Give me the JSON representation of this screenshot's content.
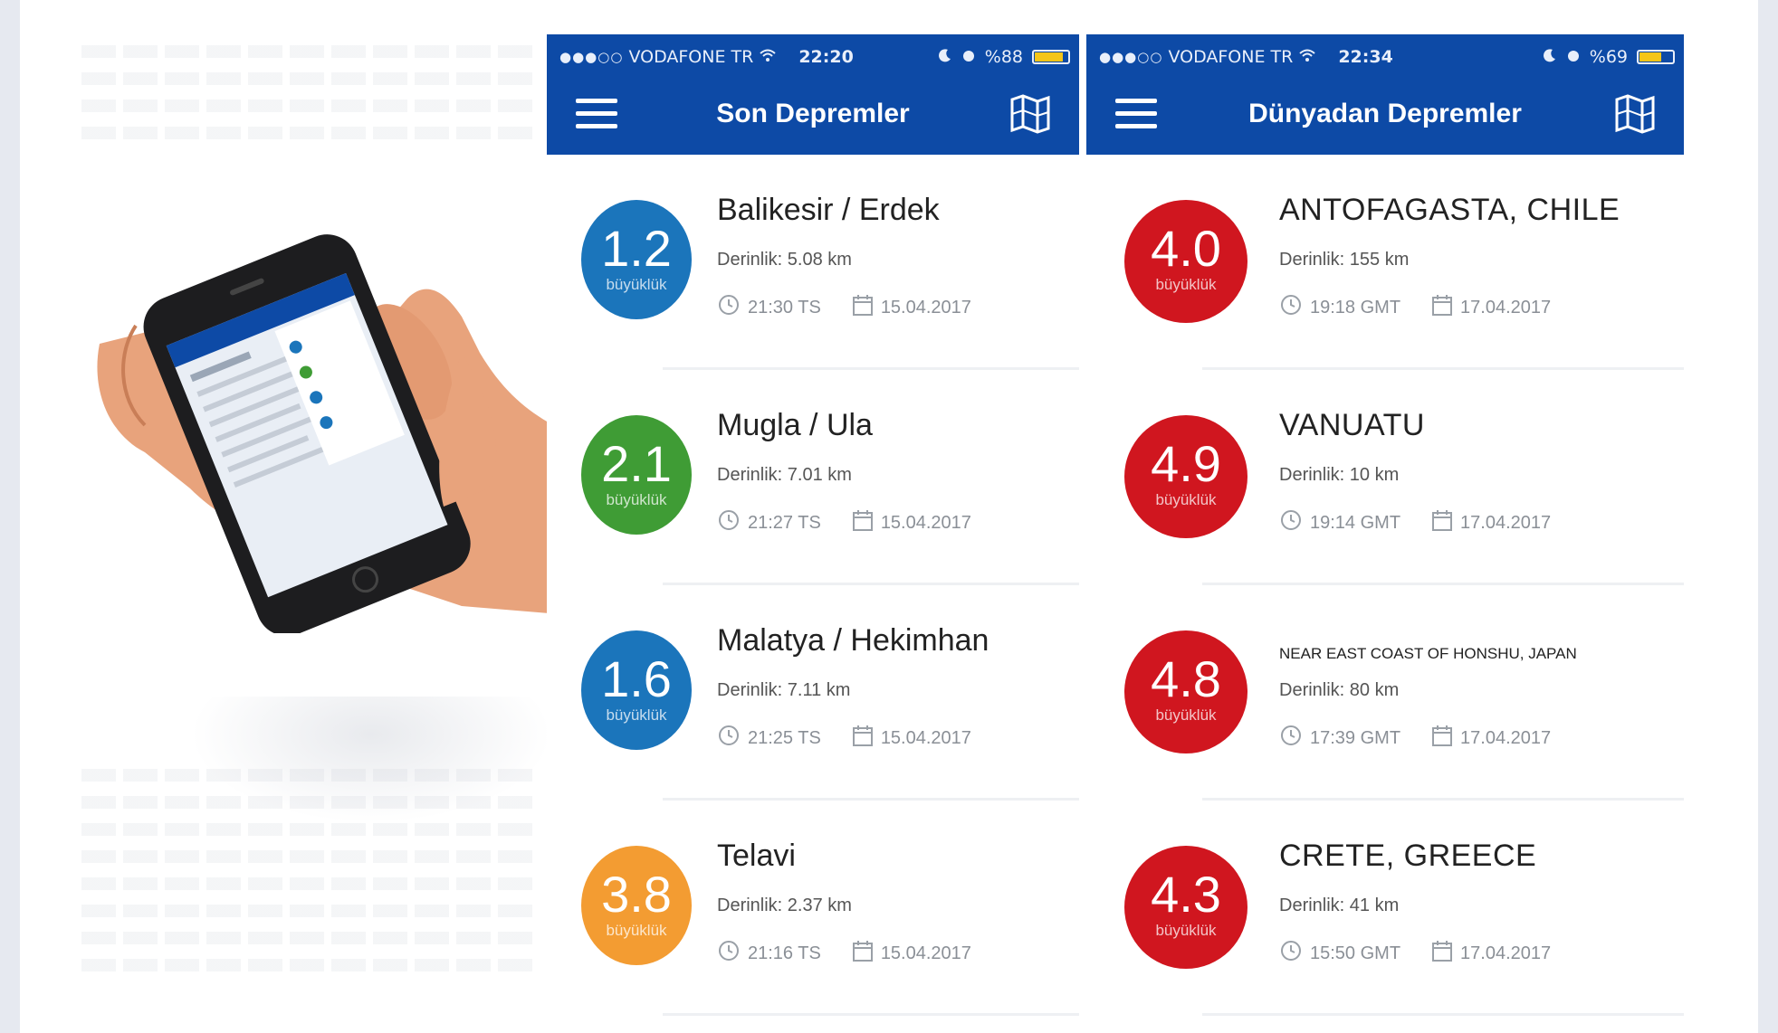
{
  "screens": [
    {
      "status": {
        "carrier": "VODAFONE TR",
        "time": "22:20",
        "battery": "%88",
        "battery_level": 0.88
      },
      "title": "Son Depremler",
      "items": [
        {
          "magnitude": "1.2",
          "unit": "büyüklük",
          "place": "Balikesir / Erdek",
          "depth": "Derinlik: 5.08 km",
          "time": "21:30 TS",
          "date": "15.04.2017",
          "color": "#1b75bb"
        },
        {
          "magnitude": "2.1",
          "unit": "büyüklük",
          "place": "Mugla / Ula",
          "depth": "Derinlik: 7.01 km",
          "time": "21:27 TS",
          "date": "15.04.2017",
          "color": "#3f9c35"
        },
        {
          "magnitude": "1.6",
          "unit": "büyüklük",
          "place": "Malatya / Hekimhan",
          "depth": "Derinlik: 7.11 km",
          "time": "21:25 TS",
          "date": "15.04.2017",
          "color": "#1b75bb"
        },
        {
          "magnitude": "3.8",
          "unit": "büyüklük",
          "place": "Telavi",
          "depth": "Derinlik: 2.37 km",
          "time": "21:16 TS",
          "date": "15.04.2017",
          "color": "#f39c32"
        }
      ]
    },
    {
      "status": {
        "carrier": "VODAFONE TR",
        "time": "22:34",
        "battery": "%69",
        "battery_level": 0.69
      },
      "title": "Dünyadan Depremler",
      "items": [
        {
          "magnitude": "4.0",
          "unit": "büyüklük",
          "place": "ANTOFAGASTA, CHILE",
          "depth": "Derinlik: 155 km",
          "time": "19:18 GMT",
          "date": "17.04.2017",
          "color": "#d0161f"
        },
        {
          "magnitude": "4.9",
          "unit": "büyüklük",
          "place": "VANUATU",
          "depth": "Derinlik: 10 km",
          "time": "19:14 GMT",
          "date": "17.04.2017",
          "color": "#d0161f"
        },
        {
          "magnitude": "4.8",
          "unit": "büyüklük",
          "place": "NEAR EAST COAST OF HONSHU, JAPAN",
          "depth": "Derinlik: 80 km",
          "time": "17:39 GMT",
          "date": "17.04.2017",
          "color": "#d0161f"
        },
        {
          "magnitude": "4.3",
          "unit": "büyüklük",
          "place": "CRETE, GREECE",
          "depth": "Derinlik: 41 km",
          "time": "15:50 GMT",
          "date": "17.04.2017",
          "color": "#d0161f"
        }
      ]
    }
  ]
}
